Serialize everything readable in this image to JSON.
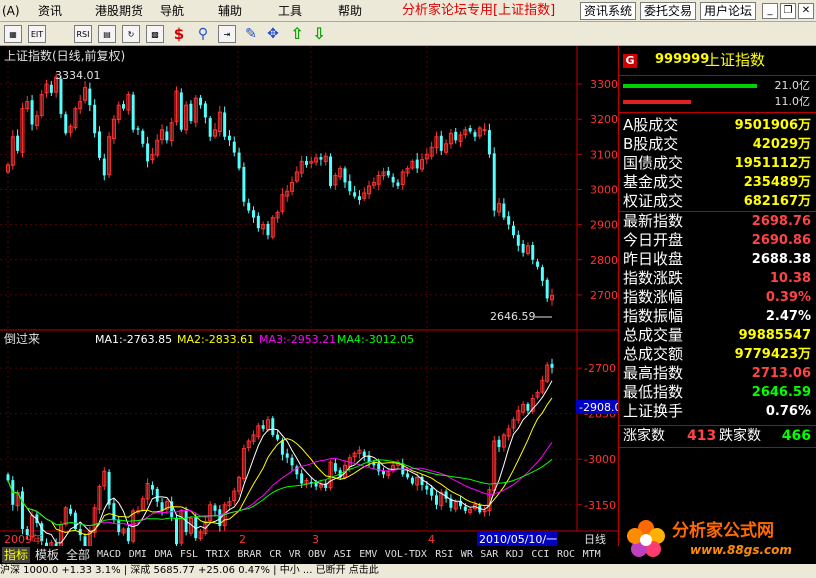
{
  "menu": {
    "items": [
      "(A)",
      "资讯",
      "港股期货",
      "导航",
      "辅助",
      "工具",
      "帮助"
    ],
    "forum_text": "分析家论坛专用",
    "index_button": "[上证指数]",
    "buttons": [
      "资讯系统",
      "委托交易",
      "用户论坛"
    ]
  },
  "toolbar": {
    "icons": [
      "chart-icon",
      "f10-icon",
      "rsi-icon",
      "multi-window-icon",
      "refresh-icon",
      "money-icon",
      "link-icon",
      "export-icon",
      "pencil-icon",
      "arrows-move-icon",
      "arrow-up-icon",
      "arrow-down-icon"
    ]
  },
  "main_chart": {
    "title": "上证指数(日线,前复权)",
    "y_ticks": [
      3300,
      3200,
      3100,
      3000,
      2900,
      2800,
      2700
    ],
    "high_label": "3334.01",
    "low_label": "2646.59",
    "candle_up_color": "#ff3232",
    "candle_down_color": "#54ffff"
  },
  "sub_chart": {
    "title": "倒过来",
    "ma_labels": [
      {
        "text": "MA1:-2763.85",
        "color": "#ffffff"
      },
      {
        "text": "MA2:-2833.61",
        "color": "#ffff00"
      },
      {
        "text": "MA3:-2953.21",
        "color": "#ff00ff"
      },
      {
        "text": "MA4:-3012.05",
        "color": "#00ff00"
      }
    ],
    "y_ticks": [
      -2700,
      -2850,
      -3000,
      -3150
    ],
    "current_value": "-2908.0"
  },
  "time_axis": {
    "start_label": "2009年",
    "month_labels": [
      "2",
      "3",
      "4"
    ],
    "cursor_date": "2010/05/10/一",
    "period": "日线"
  },
  "chart_data": {
    "type": "candlestick",
    "title": "上证指数(日线,前复权)",
    "ylim": [
      2600,
      3400
    ],
    "x_labels": [
      "2009年",
      "2",
      "3",
      "4"
    ],
    "close_series": [
      3070,
      3150,
      3110,
      3230,
      3250,
      3185,
      3210,
      3270,
      3300,
      3275,
      3320,
      3215,
      3160,
      3180,
      3230,
      3250,
      3290,
      3240,
      3160,
      3090,
      3040,
      3150,
      3200,
      3240,
      3230,
      3270,
      3170,
      3170,
      3130,
      3080,
      3100,
      3140,
      3170,
      3140,
      3190,
      3280,
      3170,
      3240,
      3195,
      3260,
      3240,
      3205,
      3150,
      3170,
      3220,
      3150,
      3140,
      3105,
      3060,
      2965,
      2940,
      2920,
      2890,
      2900,
      2870,
      2920,
      2935,
      2985,
      2995,
      3020,
      3050,
      3080,
      3070,
      3080,
      3090,
      3085,
      3095,
      3010,
      3040,
      3060,
      3020,
      2995,
      2980,
      2970,
      2990,
      3010,
      3020,
      3040,
      3050,
      3040,
      3020,
      3010,
      3050,
      3060,
      3080,
      3060,
      3085,
      3100,
      3120,
      3150,
      3110,
      3130,
      3160,
      3140,
      3155,
      3170,
      3165,
      3150,
      3175,
      3170,
      3100,
      2940,
      2960,
      2920,
      2900,
      2870,
      2840,
      2820,
      2840,
      2800,
      2780,
      2740,
      2690,
      2698.76
    ],
    "last_close": 2698.76,
    "high": 3334.01,
    "low": 2646.59
  },
  "quote": {
    "code": "999999",
    "name": "上证指数",
    "bar1_value": "21.0亿",
    "bar1_color": "#00d000",
    "bar2_value": "11.0亿",
    "bar2_color": "#e02020",
    "rows": [
      {
        "label": "A股成交",
        "value": "9501906万",
        "color": "#ffff00"
      },
      {
        "label": "B股成交",
        "value": "42029万",
        "color": "#ffff00"
      },
      {
        "label": "国债成交",
        "value": "1951112万",
        "color": "#ffff00"
      },
      {
        "label": "基金成交",
        "value": "235489万",
        "color": "#ffff00"
      },
      {
        "label": "权证成交",
        "value": "682167万",
        "color": "#ffff00"
      },
      {
        "label": "最新指数",
        "value": "2698.76",
        "color": "#ff4444"
      },
      {
        "label": "今日开盘",
        "value": "2690.86",
        "color": "#ff4444"
      },
      {
        "label": "昨日收盘",
        "value": "2688.38",
        "color": "#ffffff"
      },
      {
        "label": "指数涨跌",
        "value": "10.38",
        "color": "#ff4444"
      },
      {
        "label": "指数涨幅",
        "value": "0.39%",
        "color": "#ff4444"
      },
      {
        "label": "指数振幅",
        "value": "2.47%",
        "color": "#ffffff"
      },
      {
        "label": "总成交量",
        "value": "99885547",
        "color": "#ffff00"
      },
      {
        "label": "总成交额",
        "value": "9779423万",
        "color": "#ffff00"
      },
      {
        "label": "最高指数",
        "value": "2713.06",
        "color": "#ff4444"
      },
      {
        "label": "最低指数",
        "value": "2646.59",
        "color": "#00ff00"
      },
      {
        "label": "上证换手",
        "value": "0.76%",
        "color": "#ffffff"
      }
    ],
    "up_label": "涨家数",
    "up_count": "413",
    "down_label": "跌家数",
    "down_count": "466"
  },
  "indicator_tabs": [
    "指标",
    "模板",
    "全部",
    "MACD",
    "DMI",
    "DMA",
    "FSL",
    "TRIX",
    "BRAR",
    "CR",
    "VR",
    "OBV",
    "ASI",
    "EMV",
    "VOL-TDX",
    "RSI",
    "WR",
    "SAR",
    "KDJ",
    "CCI",
    "ROC",
    "MTM"
  ],
  "logo": {
    "text": "分析家公式网",
    "url": "www.88gs.com"
  },
  "status": {
    "text": "沪深 1000.0 +1.33 3.1% | 深成 5685.77 +25.06 0.47% | 中小 ... 已断开 点击此"
  }
}
